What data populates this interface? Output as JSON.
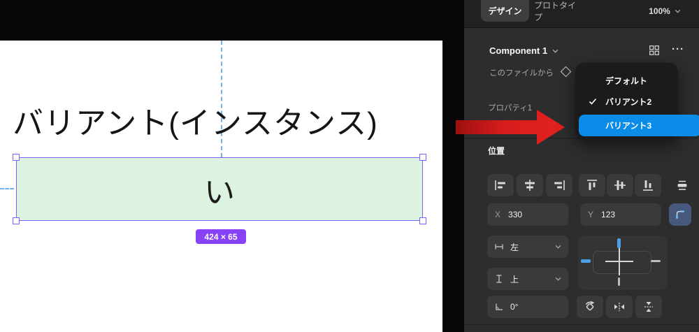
{
  "canvas": {
    "title": "バリアント(インスタンス)",
    "selection": {
      "text": "い",
      "size_badge": "424 × 65"
    }
  },
  "panel": {
    "tabs": {
      "design": "デザイン",
      "prototype": "プロトタイプ",
      "zoom_level": "100%"
    },
    "component": {
      "name": "Component 1",
      "source_label": "このファイルから",
      "property_label": "プロパティ1",
      "more_icon_glyph": "···"
    },
    "variant_menu": {
      "items": [
        {
          "label": "デフォルト"
        },
        {
          "label": "バリアント2",
          "checked": true
        },
        {
          "label": "バリアント3",
          "selected": true
        }
      ]
    },
    "position": {
      "heading": "位置",
      "x_label": "X",
      "x_value": "330",
      "y_label": "Y",
      "y_value": "123",
      "h_constraint": "左",
      "v_constraint": "上",
      "rotation_value": "0°"
    }
  },
  "colors": {
    "accent_blue": "#0c8ce9",
    "selection_purple": "#7b61ff",
    "badge_purple": "#8642f4",
    "variant_fill_green": "#ddf3e1",
    "arrow_red": "#d71d1d",
    "guide_blue": "#70b2e8"
  }
}
